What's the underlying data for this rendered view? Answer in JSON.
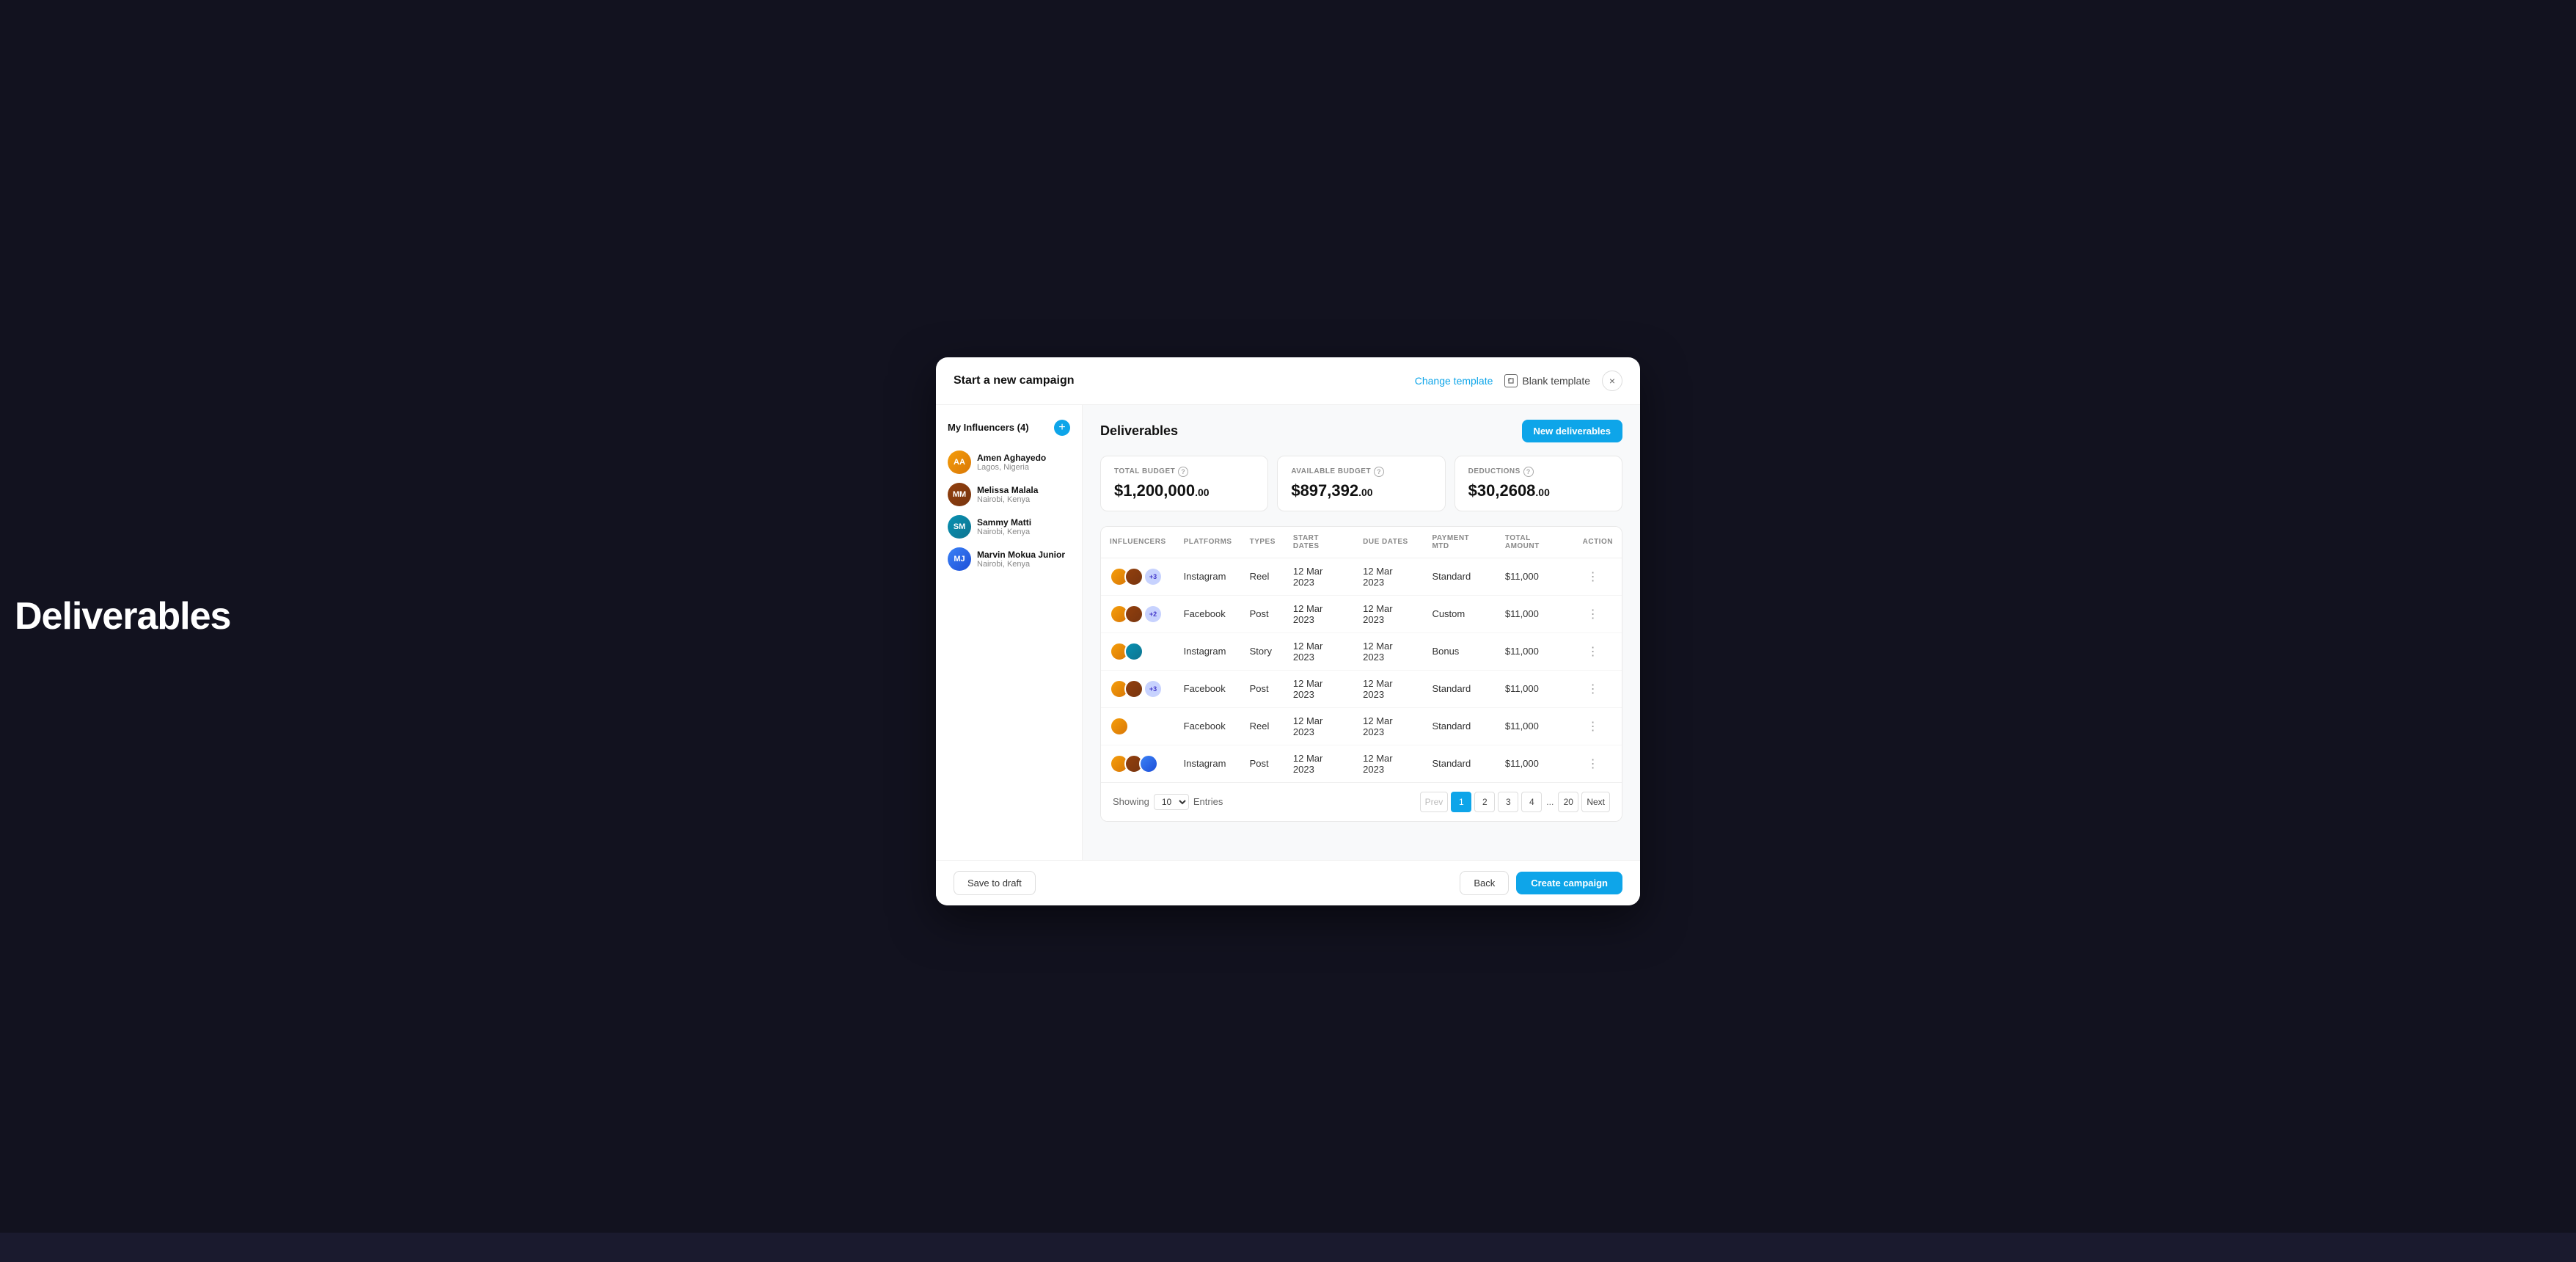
{
  "background": {
    "color": "#12121f",
    "page_label": "Deliverables"
  },
  "modal": {
    "title": "Start a new campaign",
    "change_template_label": "Change template",
    "blank_template_label": "Blank template",
    "close_label": "×"
  },
  "sidebar": {
    "header": "My Influencers (4)",
    "add_icon": "+",
    "influencers": [
      {
        "name": "Amen Aghayedo",
        "location": "Lagos, Nigeria",
        "initials": "AA",
        "color": "av-orange"
      },
      {
        "name": "Melissa Malala",
        "location": "Nairobi, Kenya",
        "initials": "MM",
        "color": "av-brown"
      },
      {
        "name": "Sammy Matti",
        "location": "Nairobi, Kenya",
        "initials": "SM",
        "color": "av-teal"
      },
      {
        "name": "Marvin Mokua Junior",
        "location": "Nairobi, Kenya",
        "initials": "MJ",
        "color": "av-blue"
      }
    ]
  },
  "deliverables": {
    "title": "Deliverables",
    "new_btn": "New deliverables",
    "budget_cards": [
      {
        "label": "TOTAL BUDGET",
        "amount": "$1,200,000",
        "cents": ".00"
      },
      {
        "label": "AVAILABLE BUDGET",
        "amount": "$897,392",
        "cents": ".00"
      },
      {
        "label": "DEDUCTIONS",
        "amount": "$30,2608",
        "cents": ".00"
      }
    ],
    "table": {
      "columns": [
        "INFLUENCERS",
        "PLATFORMS",
        "TYPES",
        "START DATES",
        "DUE DATES",
        "PAYMENT MTD",
        "TOTAL AMOUNT",
        "ACTION"
      ],
      "rows": [
        {
          "avatars": [
            "av-orange",
            "av-brown"
          ],
          "extra": "+3",
          "platform": "Instagram",
          "type": "Reel",
          "start": "12 Mar 2023",
          "due": "12 Mar 2023",
          "payment": "Standard",
          "amount": "$11,000"
        },
        {
          "avatars": [
            "av-orange",
            "av-brown"
          ],
          "extra": "+2",
          "platform": "Facebook",
          "type": "Post",
          "start": "12 Mar 2023",
          "due": "12 Mar 2023",
          "payment": "Custom",
          "amount": "$11,000"
        },
        {
          "avatars": [
            "av-orange",
            "av-teal"
          ],
          "extra": null,
          "platform": "Instagram",
          "type": "Story",
          "start": "12 Mar 2023",
          "due": "12 Mar 2023",
          "payment": "Bonus",
          "amount": "$11,000"
        },
        {
          "avatars": [
            "av-orange",
            "av-brown"
          ],
          "extra": "+3",
          "platform": "Facebook",
          "type": "Post",
          "start": "12 Mar 2023",
          "due": "12 Mar 2023",
          "payment": "Standard",
          "amount": "$11,000"
        },
        {
          "avatars": [
            "av-orange"
          ],
          "extra": null,
          "platform": "Facebook",
          "type": "Reel",
          "start": "12 Mar 2023",
          "due": "12 Mar 2023",
          "payment": "Standard",
          "amount": "$11,000"
        },
        {
          "avatars": [
            "av-orange",
            "av-brown",
            "av-blue"
          ],
          "extra": null,
          "platform": "Instagram",
          "type": "Post",
          "start": "12 Mar 2023",
          "due": "12 Mar 2023",
          "payment": "Standard",
          "amount": "$11,000"
        }
      ]
    },
    "pagination": {
      "showing_label": "Showing",
      "entries_value": "10",
      "entries_label": "Entries",
      "prev_label": "Prev",
      "next_label": "Next",
      "pages": [
        "1",
        "2",
        "3",
        "4",
        "...",
        "20"
      ],
      "active_page": "1"
    }
  },
  "footer": {
    "save_draft_label": "Save to draft",
    "back_label": "Back",
    "create_campaign_label": "Create campaign"
  }
}
